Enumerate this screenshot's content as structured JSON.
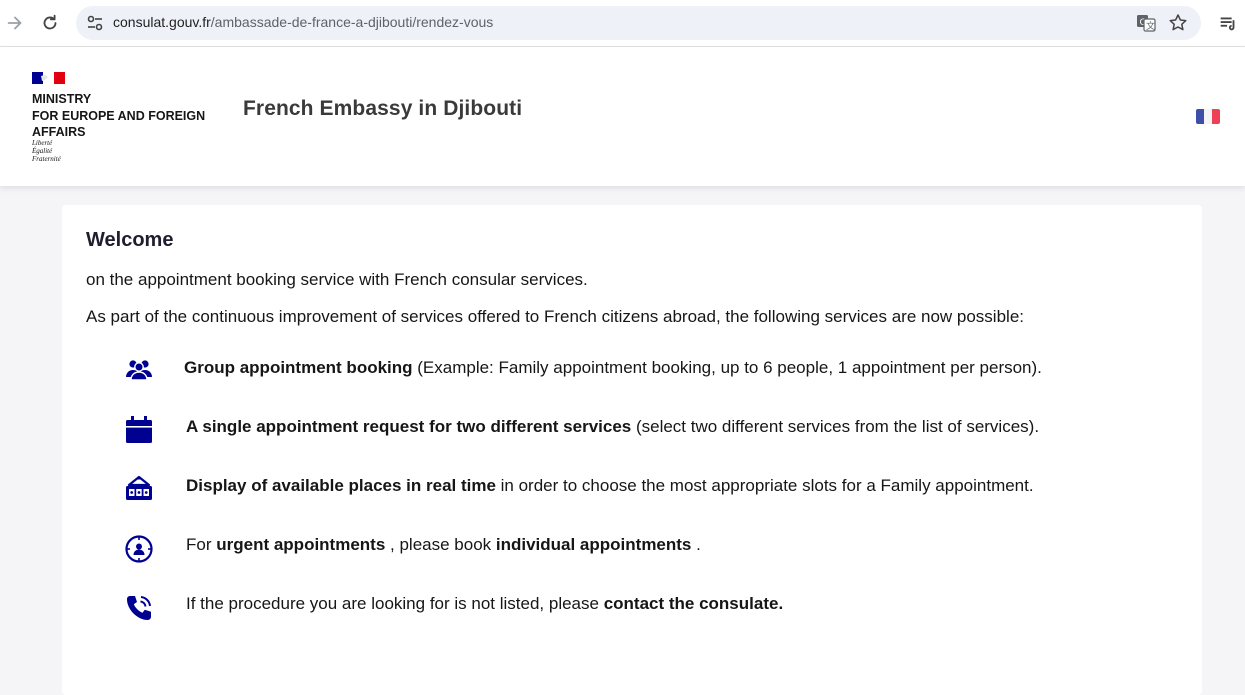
{
  "browser": {
    "url_host": "consulat.gouv.fr",
    "url_path": "/ambassade-de-france-a-djibouti/rendez-vous"
  },
  "header": {
    "ministry_lines": [
      "MINISTRY",
      "FOR EUROPE AND FOREIGN",
      "AFFAIRS"
    ],
    "motto_lines": [
      "Liberté",
      "Égalité",
      "Fraternité"
    ],
    "site_title": "French Embassy in Djibouti"
  },
  "content": {
    "welcome": "Welcome",
    "intro1": "on the appointment booking service with French consular services.",
    "intro2": "As part of the continuous improvement of services offered to French citizens abroad, the following services are now possible:",
    "features": [
      {
        "bold": "Group appointment booking",
        "rest": " (Example: Family appointment booking, up to 6 people, 1 appointment per person)."
      },
      {
        "bold": "A single appointment request for two different services",
        "rest": " (select two different services from the list of services)."
      },
      {
        "bold": "Display of available places in real time",
        "rest": " in order to choose the most appropriate slots for a Family appointment."
      },
      {
        "pre": "For ",
        "bold": "urgent appointments",
        "mid": " , please book ",
        "bold2": "individual appointments",
        "rest": " ."
      },
      {
        "pre": "If the procedure you are looking for is not listed, please ",
        "bold": "contact the consulate."
      }
    ]
  },
  "icons": {
    "back": "arrow-forward-icon",
    "reload": "reload-icon",
    "site_info": "tune-icon",
    "translate": "translate-icon",
    "bookmark": "star-icon",
    "reading_list": "playlist-icon",
    "features": [
      "group-icon",
      "calendar-icon",
      "counter-icon",
      "clock-person-icon",
      "phone-icon"
    ]
  },
  "colors": {
    "icon_blue": "#000091",
    "flag_blue": "#000091",
    "flag_red": "#e1000f",
    "omnibox_bg": "#eef1f8"
  }
}
